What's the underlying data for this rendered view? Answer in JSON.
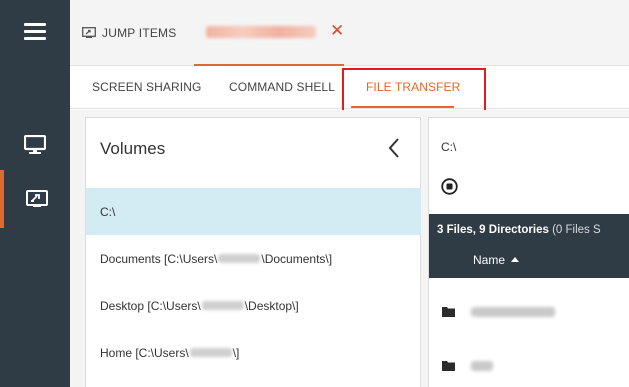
{
  "topbar": {
    "jump_items_label": "JUMP ITEMS",
    "session_close_glyph": "✕"
  },
  "subtabs": {
    "screen_sharing": "SCREEN SHARING",
    "command_shell": "COMMAND SHELL",
    "file_transfer": "FILE TRANSFER",
    "active": "FILE TRANSFER"
  },
  "volumes": {
    "title": "Volumes",
    "items": [
      {
        "label": "C:\\",
        "selected": true
      },
      {
        "prefix": "Documents [C:\\Users\\",
        "suffix": "\\Documents\\]"
      },
      {
        "prefix": "Desktop [C:\\Users\\",
        "suffix": "\\Desktop\\]"
      },
      {
        "prefix": "Home [C:\\Users\\",
        "suffix": "\\]"
      }
    ]
  },
  "files": {
    "path": "C:\\",
    "summary_bold": "3 Files, 9 Directories",
    "summary_light": "(0 Files S",
    "name_column": "Name"
  },
  "colors": {
    "rail": "#2f3b45",
    "accent": "#e0682b",
    "selected_row": "#d3ecf4",
    "annotation_box": "#e11d1d"
  },
  "icons": {
    "menu": "hamburger-icon",
    "screen": "monitor-icon",
    "jump": "jump-client-icon",
    "back": "chevron-left-icon",
    "stop": "stop-circle-icon",
    "folder": "folder-icon",
    "sort": "sort-ascending-icon"
  }
}
